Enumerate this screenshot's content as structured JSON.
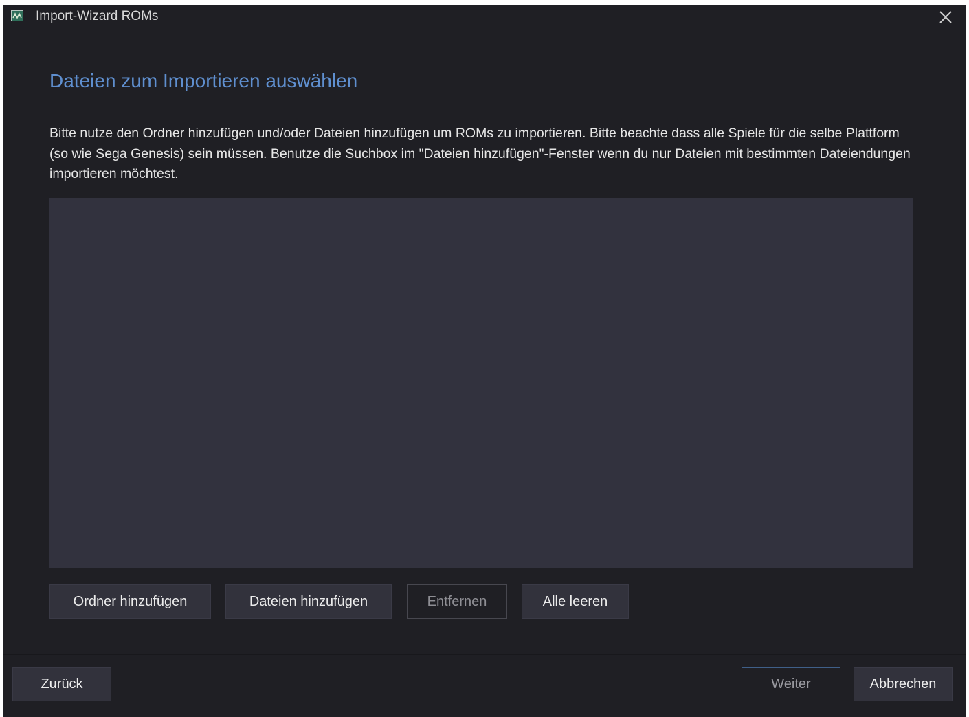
{
  "window": {
    "title": "Import-Wizard ROMs",
    "icon": "app-logo-icon",
    "close_icon": "close-icon"
  },
  "main": {
    "heading": "Dateien zum Importieren auswählen",
    "description": "Bitte nutze den Ordner hinzufügen und/oder Dateien hinzufügen um ROMs zu importieren. Bitte beachte dass alle Spiele für die selbe Plattform (so wie Sega Genesis) sein müssen. Benutze die Suchbox im \"Dateien hinzufügen\"-Fenster wenn du nur Dateien mit bestimmten Dateiendungen importieren möchtest.",
    "file_list": []
  },
  "actions": {
    "add_folder": "Ordner hinzufügen",
    "add_files": "Dateien hinzufügen",
    "remove": "Entfernen",
    "clear_all": "Alle leeren"
  },
  "footer": {
    "back": "Zurück",
    "next": "Weiter",
    "cancel": "Abbrechen"
  },
  "colors": {
    "window_bg": "#1f1f24",
    "heading": "#5f8fcf",
    "list_bg": "#32323e",
    "button_bg": "#32323c",
    "focus_border": "#3f5f88"
  }
}
